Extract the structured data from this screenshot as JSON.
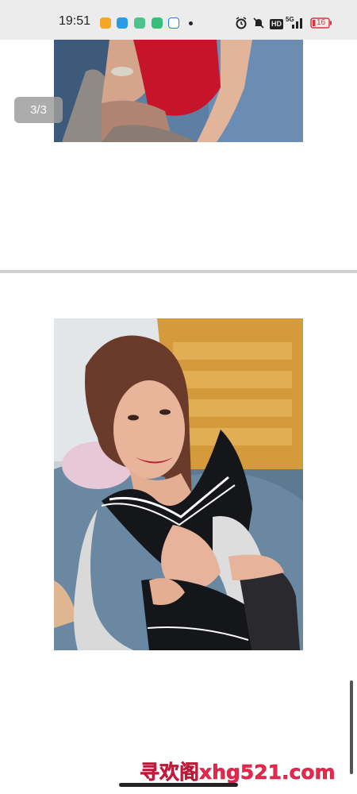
{
  "status_bar": {
    "time": "19:51",
    "network": "5G",
    "hd_label": "HD",
    "battery": "16"
  },
  "gallery": {
    "page_indicator": "3/3"
  },
  "watermark": {
    "text": "寻欢阁xhg521.com"
  }
}
